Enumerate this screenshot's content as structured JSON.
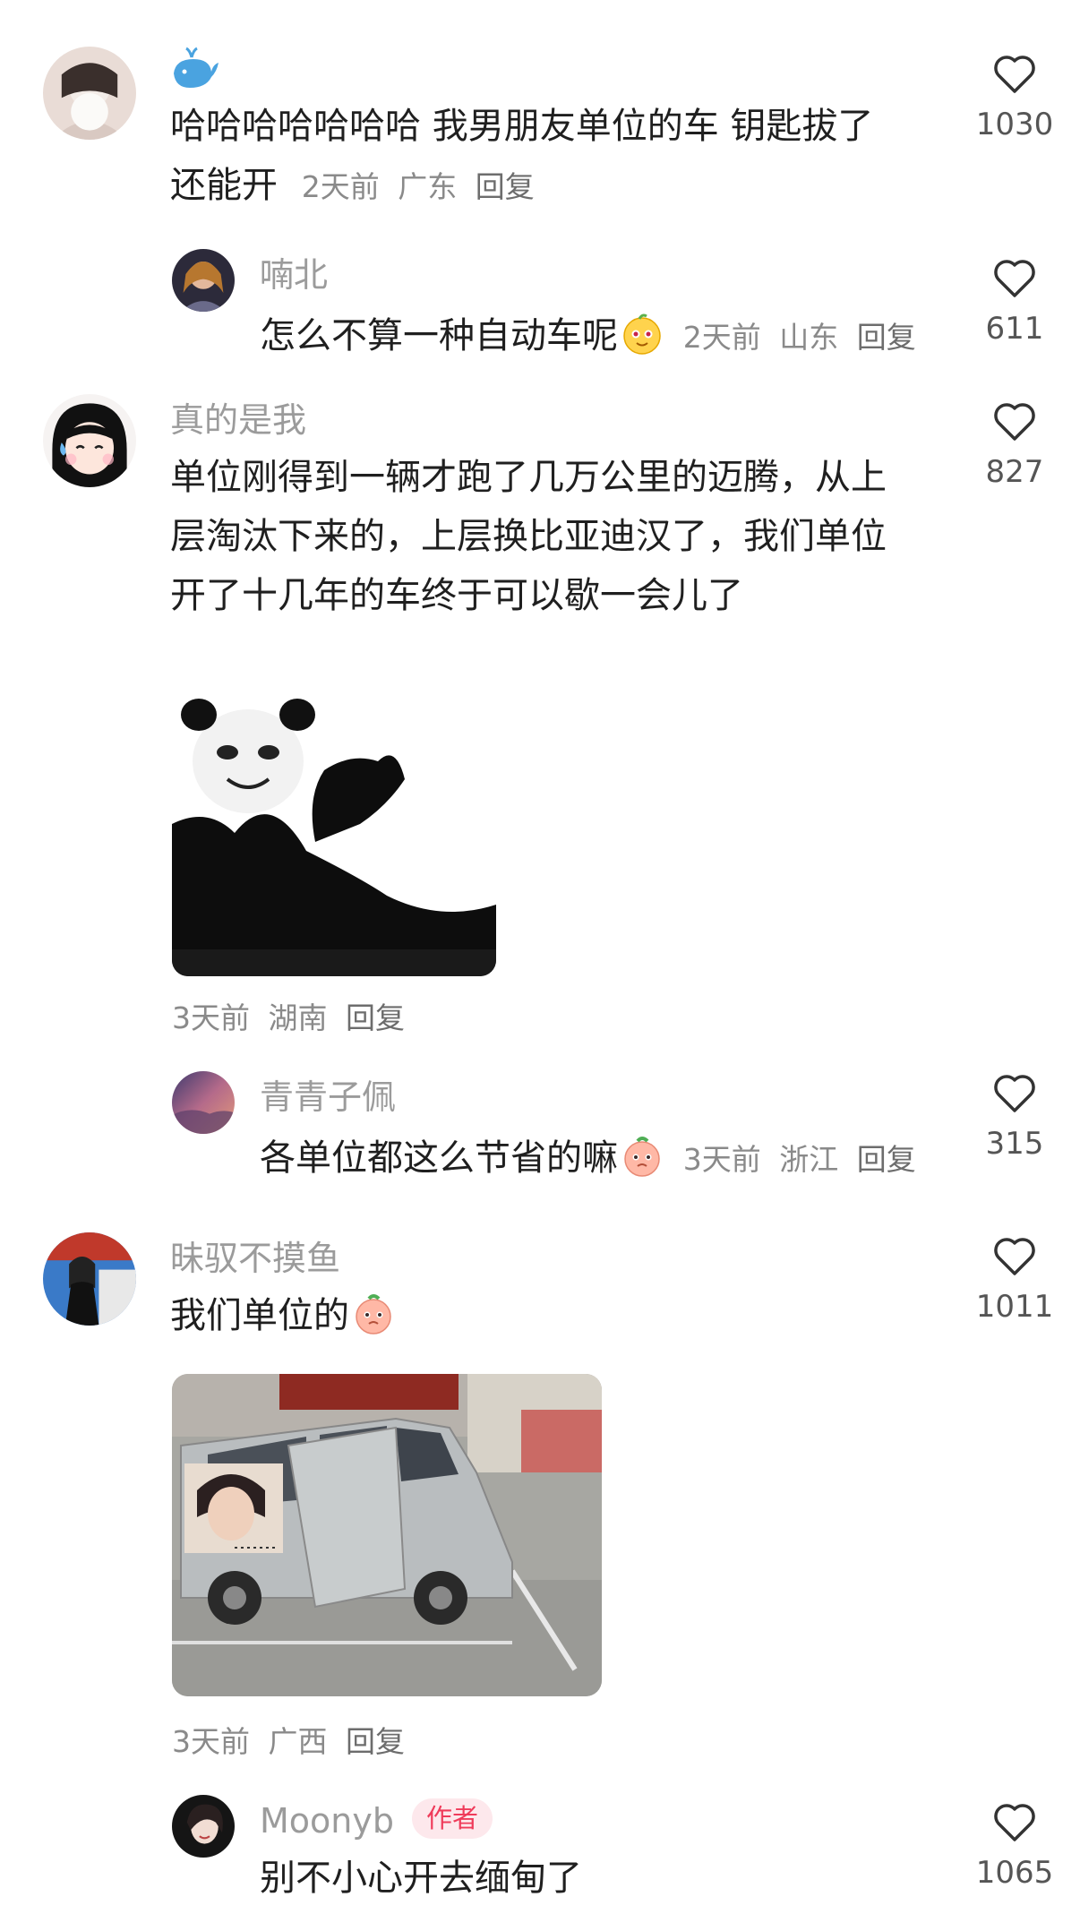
{
  "comments": [
    {
      "name": "",
      "name_icon": "whale-icon",
      "text_line1": "哈哈哈哈哈哈哈 我男朋友单位的车 钥匙拔了",
      "text_line2": "还能开",
      "time": "2天前",
      "location": "广东",
      "reply": "回复",
      "likes": "1030"
    },
    {
      "name": "喃北",
      "text": "怎么不算一种自动车呢",
      "emoji": "yellow-face-emoji",
      "time": "2天前",
      "location": "山东",
      "reply": "回复",
      "likes": "611"
    },
    {
      "name": "真的是我",
      "text_line1": "单位刚得到一辆才跑了几万公里的迈腾，从上",
      "text_line2": "层淘汰下来的，上层换比亚迪汉了，我们单位",
      "text_line3": "开了十几年的车终于可以歇一会儿了",
      "sticker": "panda-meme-sticker",
      "time": "3天前",
      "location": "湖南",
      "reply": "回复",
      "likes": "827"
    },
    {
      "name": "青青子佩",
      "text": "各单位都这么节省的嘛",
      "emoji": "peach-face-emoji",
      "time": "3天前",
      "location": "浙江",
      "reply": "回复",
      "likes": "315"
    },
    {
      "name": "昧驭不摸鱼",
      "text": "我们单位的",
      "emoji": "peach-face-emoji",
      "image": "minivan-photo",
      "time": "3天前",
      "location": "广西",
      "reply": "回复",
      "likes": "1011"
    },
    {
      "name": "Moonyb",
      "badge": "作者",
      "text": "别不小心开去缅甸了",
      "likes": "1065"
    }
  ],
  "colors": {
    "name": "#9b9b9b",
    "text": "#1f1f1f",
    "meta": "#8a8a8a",
    "badge_bg": "#fde8ec",
    "badge_fg": "#ef3b5a"
  }
}
